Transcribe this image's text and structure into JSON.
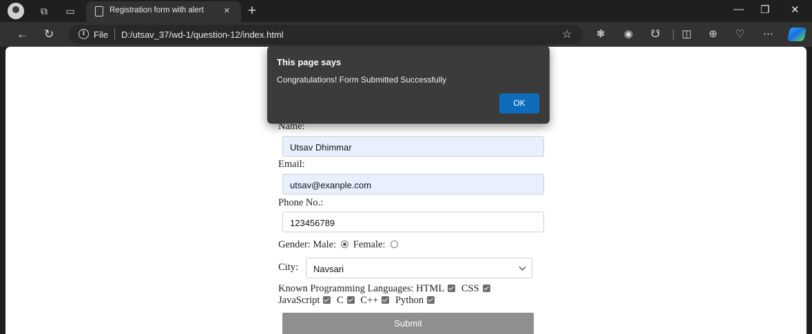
{
  "browser": {
    "tab_title": "Registration form with alert",
    "tab_close": "×",
    "new_tab": "+",
    "scheme_label": "File",
    "url": "D:/utsav_37/wd-1/question-12/index.html"
  },
  "dialog": {
    "title": "This page says",
    "message": "Congratulations! Form Submitted Successfully",
    "ok_label": "OK"
  },
  "form": {
    "name_label": "Name:",
    "name_value": "Utsav Dhimmar",
    "email_label": "Email:",
    "email_value": "utsav@exanple.com",
    "phone_label": "Phone No.:",
    "phone_value": "123456789",
    "gender_label": "Gender:",
    "gender_male": "Male:",
    "gender_female": "Female:",
    "gender_selected": "Male",
    "city_label": "City:",
    "city_value": "Navsari",
    "languages_label": "Known Programming Languages:",
    "languages": [
      "HTML",
      "CSS",
      "JavaScript",
      "C",
      "C++",
      "Python"
    ],
    "submit_label": "Submit"
  },
  "colors": {
    "ok_button": "#0f6cbd",
    "autofill_bg": "#e8f0fe",
    "submit_bg": "#8f8f8f"
  }
}
